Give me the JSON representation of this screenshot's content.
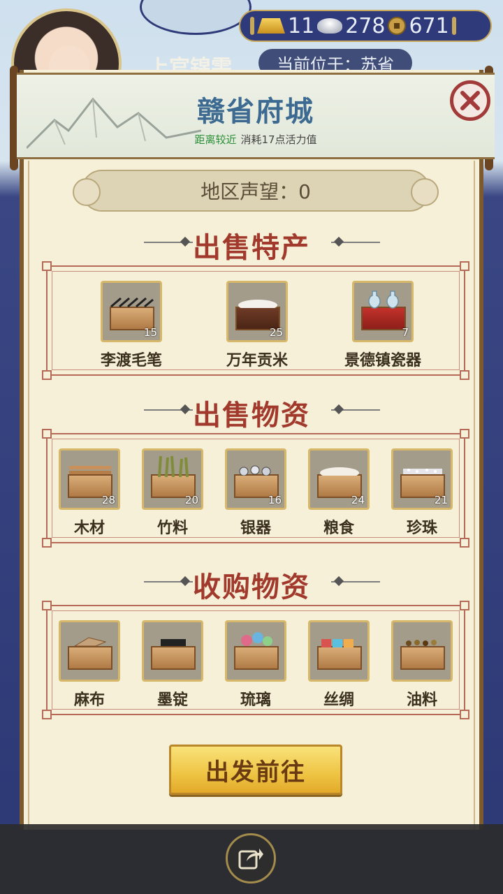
{
  "hud": {
    "gold": "11",
    "silver": "278",
    "coins": "671",
    "player_name": "上官锦雯",
    "location": "当前位于：苏省"
  },
  "popup": {
    "city_name": "赣省府城",
    "distance_text": "距离较近",
    "cost_text": "消耗17点活力值",
    "reputation": "地区声望：0",
    "sections": [
      {
        "title": "出售特产",
        "items": [
          {
            "name": "李渡毛笔",
            "count": "15",
            "icon": "brush-crate-icon"
          },
          {
            "name": "万年贡米",
            "count": "25",
            "icon": "rice-box-icon"
          },
          {
            "name": "景德镇瓷器",
            "count": "7",
            "icon": "porcelain-box-icon"
          }
        ]
      },
      {
        "title": "出售物资",
        "items": [
          {
            "name": "木材",
            "count": "28",
            "icon": "wood-crate-icon"
          },
          {
            "name": "竹料",
            "count": "20",
            "icon": "bamboo-crate-icon"
          },
          {
            "name": "银器",
            "count": "16",
            "icon": "silverware-crate-icon"
          },
          {
            "name": "粮食",
            "count": "24",
            "icon": "grain-crate-icon"
          },
          {
            "name": "珍珠",
            "count": "21",
            "icon": "pearl-crate-icon"
          }
        ]
      },
      {
        "title": "收购物资",
        "items": [
          {
            "name": "麻布",
            "icon": "linen-crate-icon"
          },
          {
            "name": "墨锭",
            "icon": "ink-crate-icon"
          },
          {
            "name": "琉璃",
            "icon": "glass-crate-icon"
          },
          {
            "name": "丝绸",
            "icon": "silk-crate-icon"
          },
          {
            "name": "油料",
            "icon": "oil-crate-icon"
          }
        ]
      }
    ],
    "depart_label": "出发前往"
  },
  "colors": {
    "title_blue": "#3d6a91",
    "section_red": "#a13a2c",
    "paper": "#f7f0d8",
    "button_gold": "#eec443"
  }
}
